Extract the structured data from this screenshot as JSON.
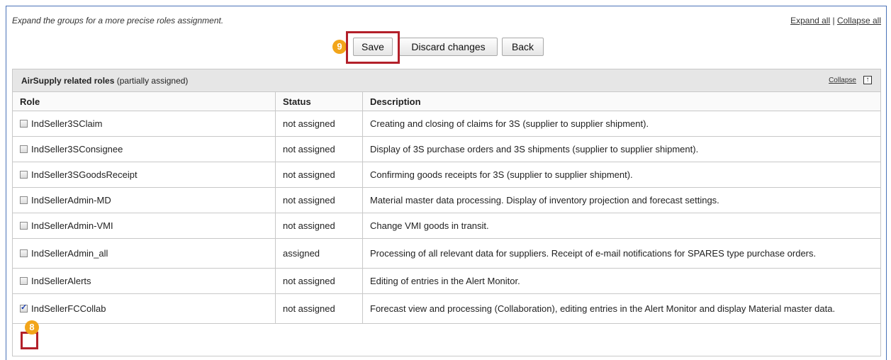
{
  "hint": "Expand the groups for a more precise roles assignment.",
  "links": {
    "expand_all": "Expand all",
    "separator": "|",
    "collapse_all": "Collapse all"
  },
  "toolbar": {
    "save": "Save",
    "discard": "Discard changes",
    "back": "Back"
  },
  "badges": {
    "save_step": "9",
    "checkbox_step": "8"
  },
  "group": {
    "title": "AirSupply related roles",
    "state": "(partially assigned)",
    "collapse_label": "Collapse",
    "collapse_icon": "collapse-up-icon"
  },
  "columns": {
    "role": "Role",
    "status": "Status",
    "description": "Description"
  },
  "rows": [
    {
      "role": "IndSeller3SClaim",
      "status": "not assigned",
      "description": "Creating and closing of claims for 3S (supplier to supplier shipment).",
      "checked": false
    },
    {
      "role": "IndSeller3SConsignee",
      "status": "not assigned",
      "description": "Display of 3S purchase orders and 3S shipments (supplier to supplier shipment).",
      "checked": false
    },
    {
      "role": "IndSeller3SGoodsReceipt",
      "status": "not assigned",
      "description": "Confirming goods receipts for 3S (supplier to supplier shipment).",
      "checked": false
    },
    {
      "role": "IndSellerAdmin-MD",
      "status": "not assigned",
      "description": "Material master data processing. Display of inventory projection and forecast settings.",
      "checked": false
    },
    {
      "role": "IndSellerAdmin-VMI",
      "status": "not assigned",
      "description": "Change VMI goods in transit.",
      "checked": false
    },
    {
      "role": "IndSellerAdmin_all",
      "status": "assigned",
      "description": "Processing of all relevant data for suppliers. Receipt of e-mail notifications for SPARES type purchase orders.",
      "checked": false
    },
    {
      "role": "IndSellerAlerts",
      "status": "not assigned",
      "description": "Editing of entries in the Alert Monitor.",
      "checked": false
    },
    {
      "role": "IndSellerFCCollab",
      "status": "not assigned",
      "description": "Forecast view and processing (Collaboration), editing entries in the Alert Monitor and display Material master data.",
      "checked": true
    }
  ],
  "colors": {
    "highlight": "#b3202a",
    "badge": "#f2a51a",
    "frame": "#4a72b8"
  }
}
